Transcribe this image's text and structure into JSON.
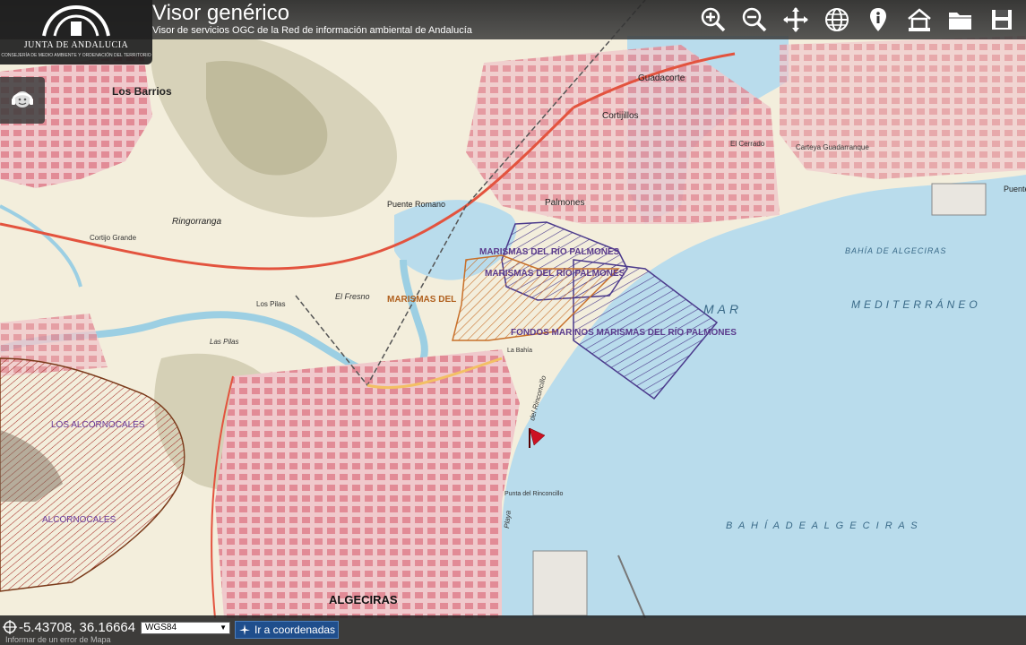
{
  "header": {
    "logo_title": "JUNTA DE ANDALUCIA",
    "logo_subtitle": "CONSEJERÍA DE MEDIO AMBIENTE Y ORDENACIÓN DEL TERRITORIO",
    "title": "Visor genérico",
    "subtitle": "Visor de servicios OGC de la Red de información ambiental de Andalucía"
  },
  "toolbar": [
    {
      "icon": "zoom-in-icon"
    },
    {
      "icon": "zoom-out-icon"
    },
    {
      "icon": "pan-icon"
    },
    {
      "icon": "globe-icon"
    },
    {
      "icon": "info-pin-icon"
    },
    {
      "icon": "home-icon"
    },
    {
      "icon": "folder-icon"
    },
    {
      "icon": "save-icon"
    }
  ],
  "side_button": {
    "icon": "support-agent-icon"
  },
  "map": {
    "place_labels": {
      "los_barrios": "Los Barrios",
      "guadacorte": "Guadacorte",
      "cortijillos": "Cortijillos",
      "palmones": "Palmones",
      "puente_romano": "Puente Romano",
      "ringorranga": "Ringorranga",
      "cortijo_grande": "Cortijo Grande",
      "el_fresno": "El Fresno",
      "los_pilas": "Los Pilas",
      "las_pilas": "Las Pilas",
      "el_cerrado": "El Cerrado",
      "carteya": "Carteya Guadarranque",
      "puente": "Puente",
      "bahia_algeciras_1": "BAHÍA DE ALGECIRAS",
      "mar": "MAR",
      "mediterraneo": "MEDITERRÁNEO",
      "bahia_algeciras_2": "B A H Í A   D E   A L G E C I R A S",
      "algeciras": "ALGECIRAS",
      "del_rinconcillo": "del Rinconcillo",
      "playa": "Playa",
      "punta_rinconcillo": "Punta del Rinconcillo",
      "la_bahia": "La Bahía"
    },
    "layer_labels": {
      "marismas_1": "MARISMAS DEL RÍO PALMONES",
      "marismas_2": "MARISMAS DEL RÍO PALMONES",
      "marismas_3": "MARISMAS DEL",
      "fondos": "FONDOS MARINOS MARISMAS DEL RÍO PALMONES",
      "alcornocales_1": "LOS ALCORNOCALES",
      "alcornocales_2": "ALCORNOCALES"
    },
    "colors": {
      "sea": "#b9dcec",
      "land": "#f3eedc",
      "urban": "#e8a0a8",
      "relief": "#b9b49a",
      "hatch_purple": "#4b3a8c",
      "hatch_orange": "#c8702a",
      "hatch_red": "#a0201a",
      "marker": "#cc1122"
    }
  },
  "footer": {
    "coordinates": "-5.43708, 36.16664",
    "hint": "Informar de un error de Mapa",
    "crs_value": "WGS84",
    "goto_label": "Ir a coordenadas"
  }
}
